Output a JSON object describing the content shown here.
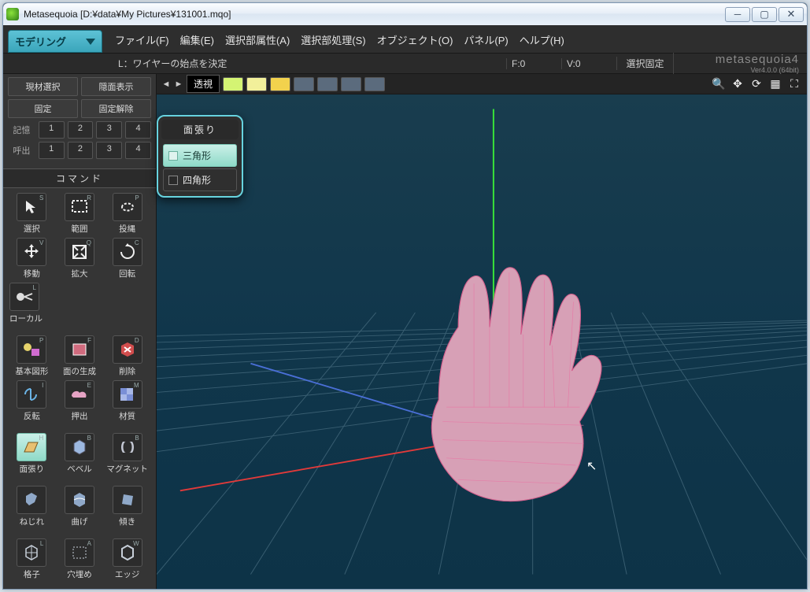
{
  "window": {
    "title": "Metasequoia [D:¥data¥My Pictures¥131001.mqo]"
  },
  "mode_tab": "モデリング",
  "menu": {
    "file": "ファイル(F)",
    "edit": "編集(E)",
    "sel_attr": "選択部属性(A)",
    "sel_proc": "選択部処理(S)",
    "object": "オブジェクト(O)",
    "panel": "パネル(P)",
    "help": "ヘルプ(H)"
  },
  "hint": "L：ワイヤーの始点を決定",
  "status": {
    "f": "F:0",
    "v": "V:0",
    "fix": "選択固定"
  },
  "brand": {
    "name": "metasequoia4",
    "ver": "Ver4.0.0 (64bit)"
  },
  "sidebar": {
    "top": {
      "cur_sel": "現材選択",
      "hide_face": "隠面表示",
      "fix": "固定",
      "unfix": "固定解除",
      "mem": "記憶",
      "call": "呼出",
      "slots": [
        "1",
        "2",
        "3",
        "4"
      ]
    },
    "cmd_header": "コマンド",
    "tools": [
      {
        "name": "選択",
        "key": "S"
      },
      {
        "name": "範囲",
        "key": "R"
      },
      {
        "name": "投縄",
        "key": "P"
      },
      {
        "name": "移動",
        "key": "V"
      },
      {
        "name": "拡大",
        "key": "Q"
      },
      {
        "name": "回転",
        "key": "C"
      },
      {
        "name": "ローカル",
        "key": "L",
        "full": true
      },
      {
        "name": "基本図形",
        "key": "P"
      },
      {
        "name": "面の生成",
        "key": "F"
      },
      {
        "name": "削除",
        "key": "D"
      },
      {
        "name": "反転",
        "key": "I"
      },
      {
        "name": "押出",
        "key": "E"
      },
      {
        "name": "材質",
        "key": "M"
      },
      {
        "name": "面張り",
        "key": "H",
        "sel": true
      },
      {
        "name": "ベベル",
        "key": "B"
      },
      {
        "name": "マグネット",
        "key": "B"
      },
      {
        "name": "ねじれ",
        "key": ""
      },
      {
        "name": "曲げ",
        "key": ""
      },
      {
        "name": "傾き",
        "key": ""
      },
      {
        "name": "格子",
        "key": "L"
      },
      {
        "name": "穴埋め",
        "key": "A"
      },
      {
        "name": "エッジ",
        "key": "W"
      }
    ]
  },
  "viewport": {
    "label": "透視",
    "chip_colors": [
      "#d4f473",
      "#f2f09a",
      "#f2d24d",
      "#5b6b7d",
      "#5b6b7d",
      "#5b6b7d",
      "#5b6b7d"
    ]
  },
  "popup": {
    "title": "面張り",
    "opt1": "三角形",
    "opt2": "四角形"
  }
}
